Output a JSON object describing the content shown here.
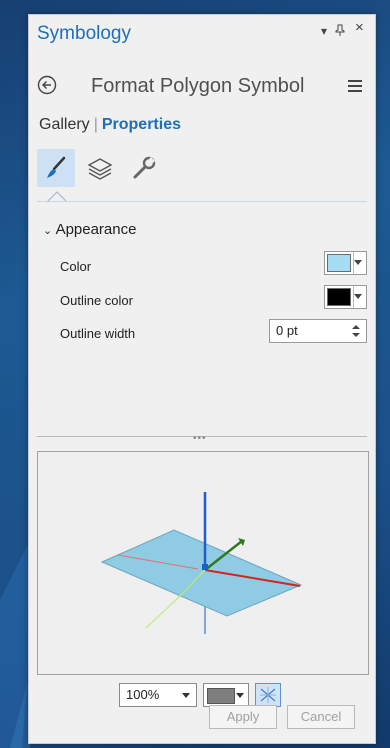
{
  "window": {
    "title": "Symbology",
    "controls": {
      "options": "▾",
      "pin": "📌",
      "close": "×"
    }
  },
  "header": {
    "title": "Format Polygon Symbol"
  },
  "tabs": {
    "gallery": "Gallery",
    "separator": "|",
    "properties": "Properties"
  },
  "section": {
    "label": "Appearance"
  },
  "properties": {
    "color": {
      "label": "Color",
      "value_hex": "#a6ddf5"
    },
    "outline_color": {
      "label": "Outline color",
      "value_hex": "#000000"
    },
    "outline_width": {
      "label": "Outline width",
      "value": "0 pt"
    }
  },
  "preview": {
    "zoom": "100%",
    "background_hex": "#7f7f7f"
  },
  "buttons": {
    "apply": "Apply",
    "cancel": "Cancel"
  },
  "colors": {
    "accent": "#1e6fba",
    "panel_bg": "#f0f0f0"
  }
}
